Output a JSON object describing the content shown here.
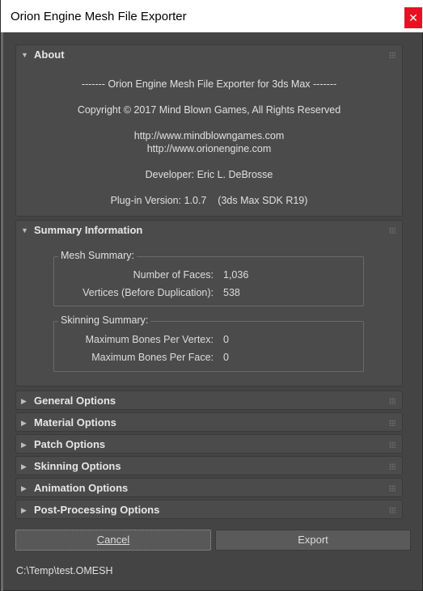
{
  "window": {
    "title": "Orion Engine Mesh File Exporter",
    "close_glyph": "✕"
  },
  "about": {
    "title": "About",
    "lines": [
      "------- Orion Engine Mesh File Exporter for 3ds Max -------",
      "Copyright © 2017 Mind Blown Games, All Rights Reserved",
      "http://www.mindblowngames.com",
      "http://www.orionengine.com",
      "Developer: Eric L. DeBrosse",
      "Plug-in Version: 1.0.7    (3ds Max SDK R19)"
    ]
  },
  "summary": {
    "title": "Summary Information",
    "mesh": {
      "label": "Mesh Summary:",
      "faces_key": "Number of Faces:",
      "faces_val": "1,036",
      "verts_key": "Vertices (Before Duplication):",
      "verts_val": "538"
    },
    "skinning": {
      "label": "Skinning Summary:",
      "bones_vertex_key": "Maximum Bones Per Vertex:",
      "bones_vertex_val": "0",
      "bones_face_key": "Maximum Bones Per Face:",
      "bones_face_val": "0"
    }
  },
  "collapsed": [
    "General Options",
    "Material Options",
    "Patch Options",
    "Skinning Options",
    "Animation Options",
    "Post-Processing Options"
  ],
  "buttons": {
    "cancel": "Cancel",
    "export": "Export"
  },
  "status_path": "C:\\Temp\\test.OMESH",
  "colors": {
    "background": "#444444",
    "panel": "#4b4b4b",
    "close": "#e81123"
  }
}
